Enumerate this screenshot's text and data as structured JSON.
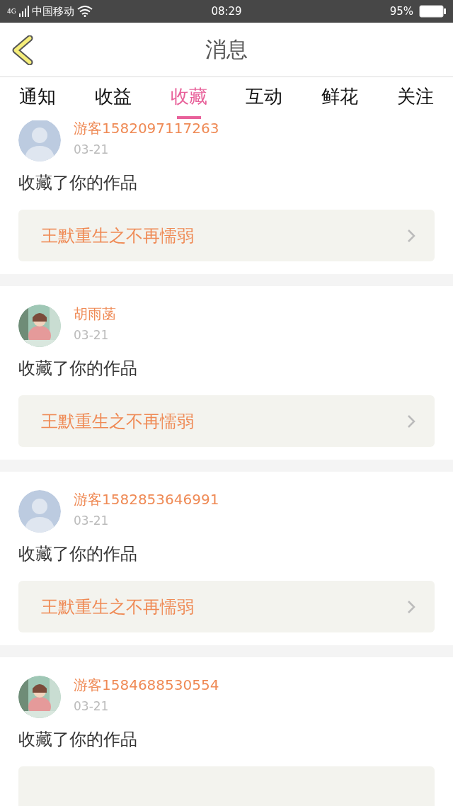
{
  "status_bar": {
    "network": "4G",
    "carrier": "中国移动",
    "time": "08:29",
    "battery_text": "95%"
  },
  "header": {
    "title": "消息"
  },
  "tabs": [
    {
      "label": "通知",
      "selected": false
    },
    {
      "label": "收益",
      "selected": false
    },
    {
      "label": "收藏",
      "selected": true
    },
    {
      "label": "互动",
      "selected": false
    },
    {
      "label": "鲜花",
      "selected": false
    },
    {
      "label": "关注",
      "selected": false
    }
  ],
  "messages": [
    {
      "kind": "default",
      "name": "游客1582097117263",
      "date": "03-21",
      "action": "收藏了你的作品",
      "work": "王默重生之不再懦弱"
    },
    {
      "kind": "picture",
      "name": "胡雨菡",
      "date": "03-21",
      "action": "收藏了你的作品",
      "work": "王默重生之不再懦弱"
    },
    {
      "kind": "default",
      "name": "游客1582853646991",
      "date": "03-21",
      "action": "收藏了你的作品",
      "work": "王默重生之不再懦弱"
    },
    {
      "kind": "picture",
      "name": "游客1584688530554",
      "date": "03-21",
      "action": "收藏了你的作品"
    }
  ]
}
